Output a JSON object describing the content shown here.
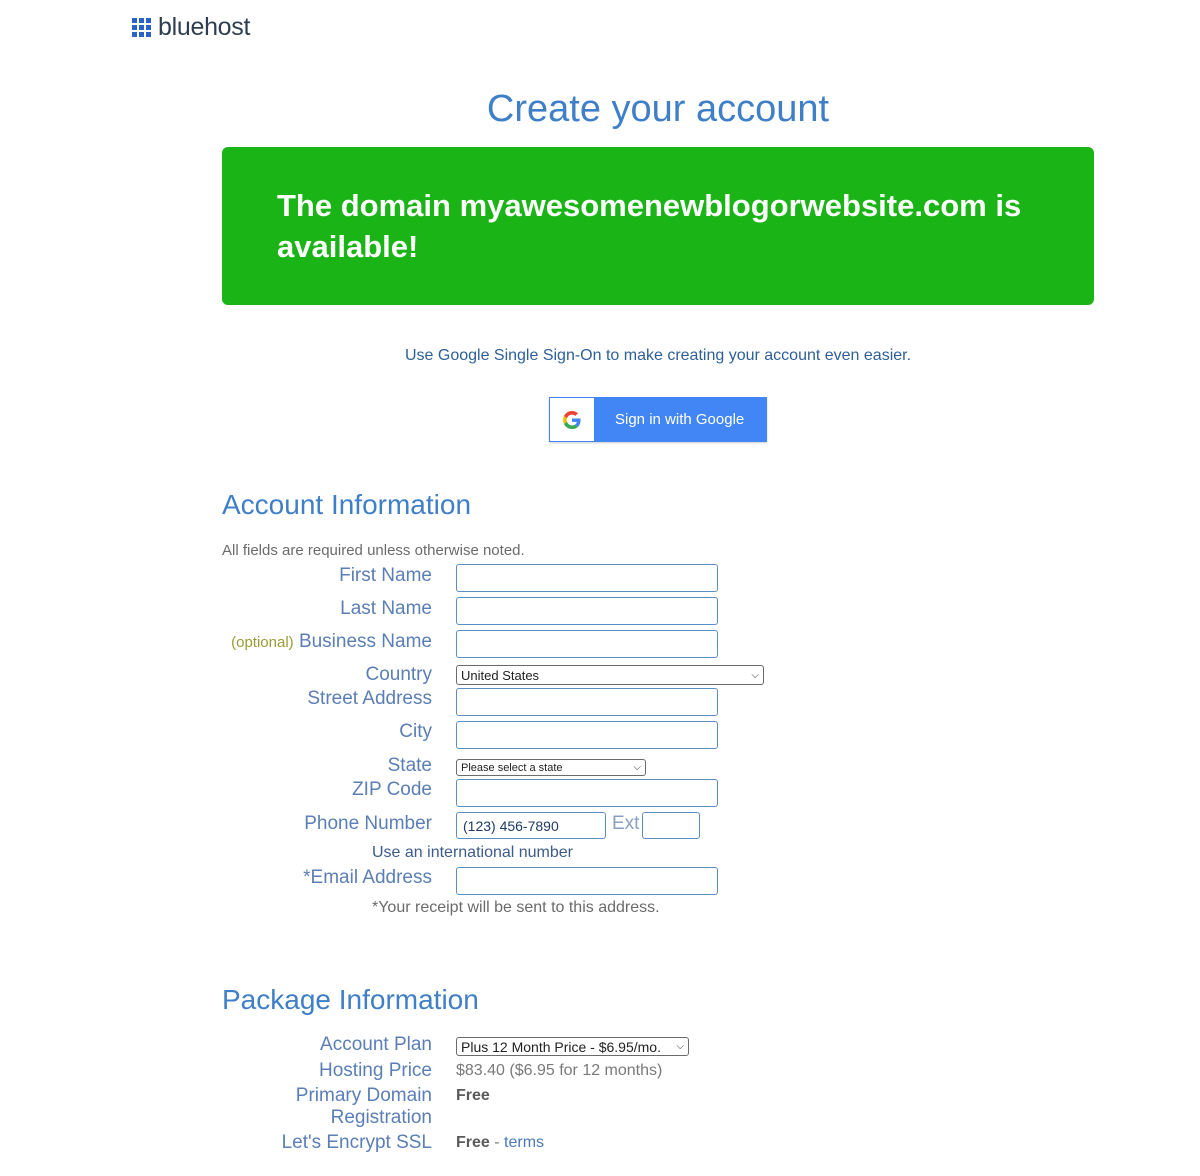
{
  "header": {
    "logo_text": "bluehost"
  },
  "page_title": "Create your account",
  "banner": {
    "message": "The domain myawesomenewblogorwebsite.com is available!"
  },
  "sso": {
    "prompt": "Use Google Single Sign-On to make creating your account even easier.",
    "button_label": "Sign in with Google"
  },
  "account": {
    "title": "Account Information",
    "note": "All fields are required unless otherwise noted.",
    "first_name_label": "First Name",
    "last_name_label": "Last Name",
    "optional_tag": "(optional)",
    "business_name_label": "Business Name",
    "country_label": "Country",
    "country_value": "United States",
    "street_label": "Street Address",
    "city_label": "City",
    "state_label": "State",
    "state_value": "Please select a state",
    "zip_label": "ZIP Code",
    "phone_label": "Phone Number",
    "phone_value": "(123) 456-7890",
    "ext_label": "Ext",
    "intl_hint": "Use an international number",
    "email_label": "*Email Address",
    "email_hint": "*Your receipt will be sent to this address."
  },
  "package": {
    "title": "Package Information",
    "plan_label": "Account Plan",
    "plan_value": "Plus 12 Month Price - $6.95/mo.",
    "hosting_label": "Hosting Price",
    "hosting_value": "$83.40  ($6.95 for 12 months)",
    "domain_label_1": "Primary Domain",
    "domain_label_2": "Registration",
    "domain_value": "Free",
    "ssl_label": "Let's Encrypt SSL",
    "ssl_value": "Free",
    "ssl_sep": " - ",
    "ssl_link": "terms"
  },
  "colors": {
    "banner_green": "#1bb416",
    "google_blue": "#4285f4",
    "title_blue": "#3f7fc7"
  }
}
